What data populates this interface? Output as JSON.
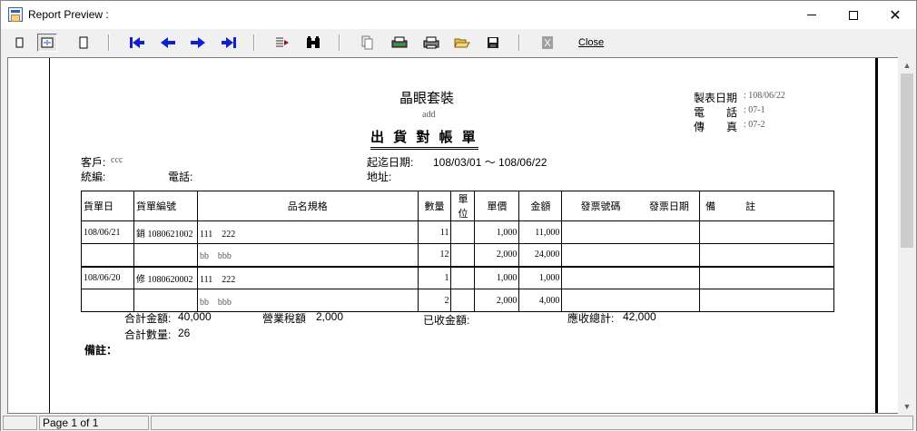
{
  "window": {
    "title": "Report Preview :"
  },
  "toolbar": {
    "close_label": "Close"
  },
  "status": {
    "page_label": "Page 1 of 1"
  },
  "report": {
    "company": "晶眼套裝",
    "company_sub": "add",
    "title": "出 貨 對 帳 單",
    "made_date_label": "製表日期",
    "made_date_value": ": 108/06/22",
    "phone_label": "電　　話",
    "phone_value": ": 07-1",
    "fax_label": "傳　　真",
    "fax_value": ": 07-2",
    "customer_label": "客戶:",
    "customer_value": "ccc",
    "tax_id_label": "統編:",
    "tel_label": "電話:",
    "period_label": "起迄日期:",
    "period_value": "108/03/01 ～ 108/06/22",
    "address_label": "地址:",
    "columns": [
      "貨單日",
      "貨單編號",
      "品名規格",
      "數量",
      "單位",
      "單價",
      "金額",
      "發票號碼",
      "發票日期",
      "備　　　註"
    ],
    "rows": [
      {
        "date": "108/06/21",
        "no": "銷 1080621002",
        "item": "111　222",
        "qty": "11",
        "unit": "",
        "price": "1,000",
        "amount": "11,000",
        "inv_no": "",
        "inv_date": "",
        "note": ""
      },
      {
        "date": "",
        "no": "",
        "item": "bb　bbb",
        "qty": "12",
        "unit": "",
        "price": "2,000",
        "amount": "24,000",
        "inv_no": "",
        "inv_date": "",
        "note": ""
      },
      {
        "date": "108/06/20",
        "no": "修 1080620002",
        "item": "111　222",
        "qty": "1",
        "unit": "",
        "price": "1,000",
        "amount": "1,000",
        "inv_no": "",
        "inv_date": "",
        "note": ""
      },
      {
        "date": "",
        "no": "",
        "item": "bb　bbb",
        "qty": "2",
        "unit": "",
        "price": "2,000",
        "amount": "4,000",
        "inv_no": "",
        "inv_date": "",
        "note": ""
      }
    ],
    "total_amount_label": "合計金額:",
    "total_amount_value": "40,000",
    "tax_label": "營業稅額",
    "tax_value": "2,000",
    "received_label": "已收金額:",
    "receivable_label": "應收總計:",
    "receivable_value": "42,000",
    "total_qty_label": "合計數量:",
    "total_qty_value": "26",
    "remarks_label": "備註："
  },
  "icons": [
    "single-page-icon",
    "two-page-icon",
    "full-page-icon",
    "first-page-icon",
    "prev-page-icon",
    "next-page-icon",
    "last-page-icon",
    "goto-page-icon",
    "search-icon",
    "copy-icon",
    "print-setup-icon",
    "print-icon",
    "open-icon",
    "save-icon",
    "export-icon"
  ]
}
